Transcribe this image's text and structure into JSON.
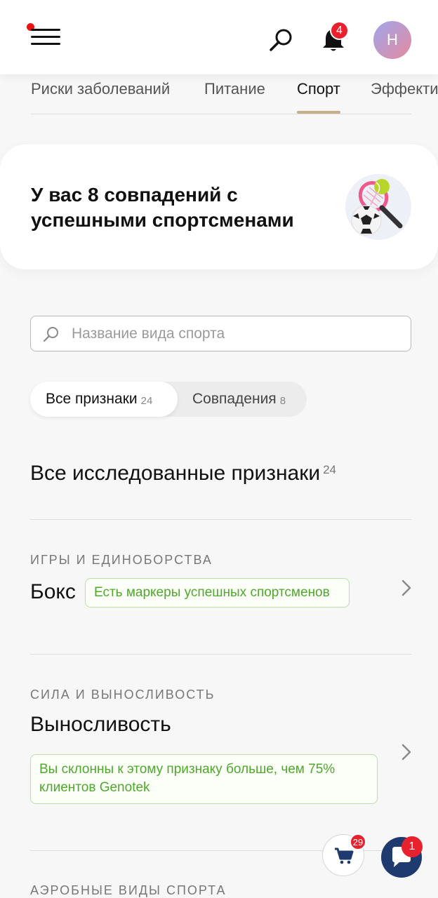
{
  "header": {
    "menu_icon": "hamburger-menu-icon",
    "search_icon": "search-icon",
    "bell_icon": "bell-icon",
    "notifications_count": "4",
    "avatar_initial": "Н",
    "accent_color": "#e8212e"
  },
  "tabs": [
    {
      "label": "Риски заболеваний",
      "active": false
    },
    {
      "label": "Питание",
      "active": false
    },
    {
      "label": "Спорт",
      "active": true
    },
    {
      "label": "Эффекти",
      "active": false
    }
  ],
  "match_card": {
    "title": "У вас 8 совпадений с успешными спортсменами",
    "illustration": "soccer-ball-tennis-racket-icon"
  },
  "search": {
    "placeholder": "Название вида спорта",
    "value": ""
  },
  "filter": {
    "all": {
      "label": "Все признаки",
      "count": "24"
    },
    "matches": {
      "label": "Совпадения",
      "count": "8"
    }
  },
  "section": {
    "title": "Все исследованные признаки",
    "count": "24"
  },
  "items": [
    {
      "category": "ИГРЫ И ЕДИНОБОРСТВА",
      "name": "Бокс",
      "tag": "Есть маркеры успешных спортсменов"
    },
    {
      "category": "СИЛА И ВЫНОСЛИВОСТЬ",
      "name": "Выносливость",
      "tag_line1": "Вы склонны к этому признаку больше, чем 75%",
      "tag_line2": "клиентов Genotek"
    },
    {
      "category": "АЭРОБНЫЕ ВИДЫ СПОРТА"
    }
  ],
  "floating": {
    "cart_count": "29",
    "chat_count": "1",
    "chat_color": "#1e3a6e"
  }
}
